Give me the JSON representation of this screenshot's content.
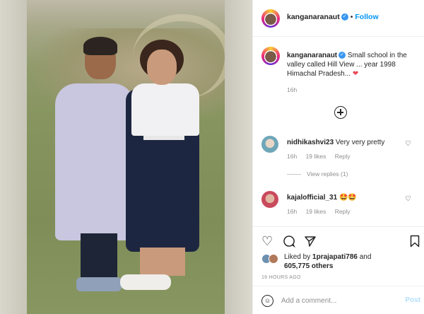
{
  "post": {
    "username": "kanganaranaut",
    "follow_label": "Follow",
    "separator": "•",
    "caption": "Small school in the valley called Hill View ... year 1998 Himachal Pradesh...",
    "caption_emoji": "❤",
    "caption_time": "16h"
  },
  "comments": [
    {
      "username": "nidhikashvi23",
      "text": "Very very pretty",
      "time": "16h",
      "likes": "19 likes",
      "reply_label": "Reply",
      "view_replies": "View replies (1)"
    },
    {
      "username": "kajalofficial_31",
      "text": "🤩🤩",
      "time": "16h",
      "likes": "19 likes",
      "reply_label": "Reply"
    }
  ],
  "actions": {
    "liked_by_prefix": "Liked by",
    "liked_by_user": "1prajapati786",
    "and_word": "and",
    "others_count": "605,775 others",
    "post_time": "16 HOURS AGO"
  },
  "comment_box": {
    "placeholder": "Add a comment...",
    "post_label": "Post"
  },
  "icons": {
    "verified": "verified-badge-icon",
    "heart": "heart-icon",
    "comment": "comment-icon",
    "share": "share-icon",
    "save": "bookmark-icon",
    "emoji": "emoji-icon",
    "add": "add-circle-icon"
  },
  "colors": {
    "accent": "#0095f6",
    "verified": "#3897f0",
    "heart": "#ed4956",
    "muted": "#8e8e8e"
  }
}
